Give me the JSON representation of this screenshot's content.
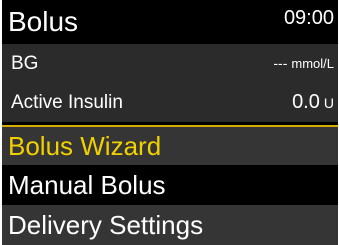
{
  "header": {
    "title": "Bolus",
    "time": "09:00"
  },
  "info": {
    "bg": {
      "label": "BG",
      "value": "---",
      "unit": "mmol/L"
    },
    "active_insulin": {
      "label": "Active Insulin",
      "value": "0.0",
      "unit": "U"
    }
  },
  "menu": {
    "items": [
      {
        "label": "Bolus Wizard",
        "selected": true
      },
      {
        "label": "Manual Bolus",
        "selected": false
      },
      {
        "label": "Delivery Settings",
        "selected": false
      }
    ]
  },
  "colors": {
    "selected_text": "#f2d000",
    "selected_border": "#d4ad00",
    "background": "#000000",
    "row_bg": "#2b2b2b"
  }
}
